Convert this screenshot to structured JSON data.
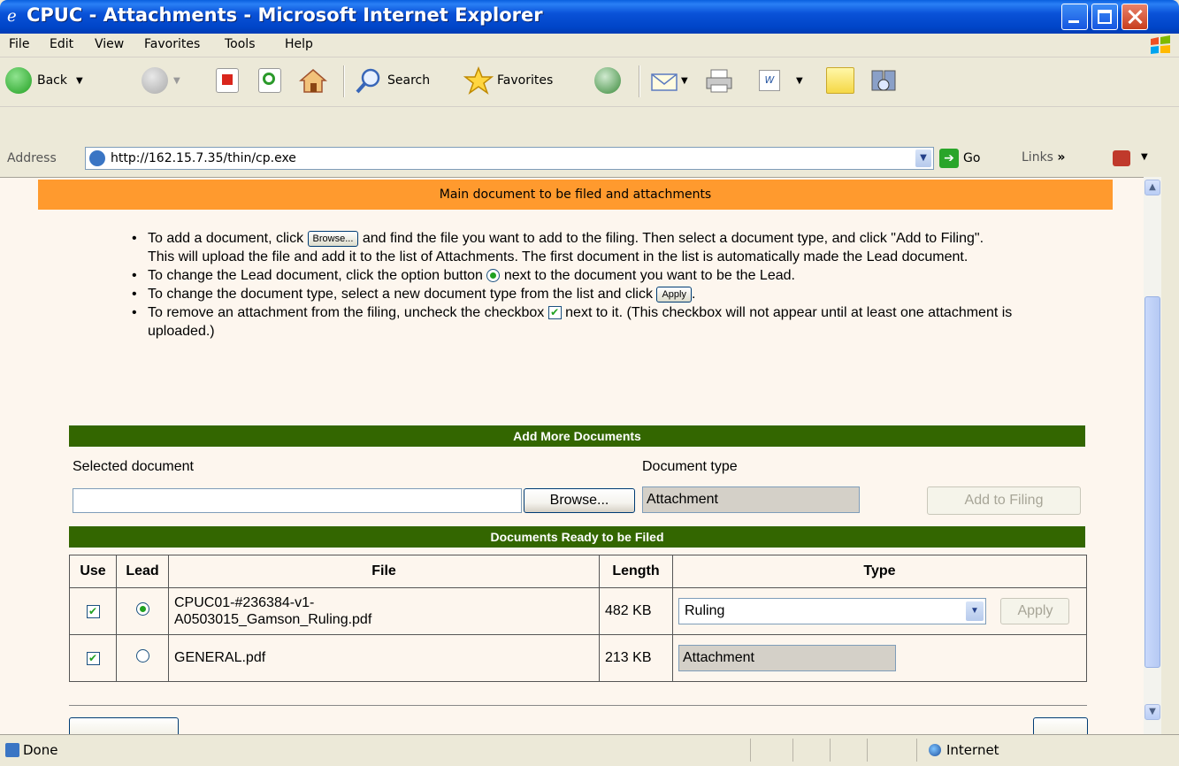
{
  "window": {
    "title": "CPUC - Attachments - Microsoft Internet Explorer"
  },
  "menu": [
    "File",
    "Edit",
    "View",
    "Favorites",
    "Tools",
    "Help"
  ],
  "toolbar": {
    "back_label": "Back",
    "search_label": "Search",
    "favorites_label": "Favorites"
  },
  "address": {
    "label": "Address",
    "url": "http://162.15.7.35/thin/cp.exe",
    "go_label": "Go",
    "links_label": "Links"
  },
  "page": {
    "header": "Main document to be filed and attachments",
    "instructions": {
      "i1_before": "To add a document, click",
      "i1_btn": "Browse...",
      "i1_after": "and find the file you want to add to the filing. Then select a document type, and click \"Add to Filing\". This will upload the file and add it to the list of Attachments. The first document in the list is automatically made the Lead document.",
      "i2_before": "To change the Lead document, click the option button",
      "i2_after": "next to the document you want to be the Lead.",
      "i3_before": "To change the document type, select a new document type from the list and click",
      "i3_btn": "Apply",
      "i3_after": ".",
      "i4_before": "To remove an attachment from the filing, uncheck the checkbox",
      "i4_after": "next to it. (This checkbox will not appear until at least one attachment is uploaded.)"
    },
    "add_more": {
      "header": "Add More Documents",
      "selected_label": "Selected document",
      "selected_value": "",
      "browse_label": "Browse...",
      "doctype_label": "Document type",
      "doctype_value": "Attachment",
      "add_button": "Add to Filing"
    },
    "ready": {
      "header": "Documents Ready to be Filed",
      "columns": [
        "Use",
        "Lead",
        "File",
        "Length",
        "Type"
      ],
      "rows": [
        {
          "use": true,
          "lead": true,
          "file_line1": "CPUC01-#236384-v1-",
          "file_line2": "A0503015_Gamson_Ruling.pdf",
          "length": "482 KB",
          "type": "Ruling",
          "apply": "Apply"
        },
        {
          "use": true,
          "lead": false,
          "file_line1": "GENERAL.pdf",
          "file_line2": "",
          "length": "213 KB",
          "type": "Attachment"
        }
      ]
    }
  },
  "status": {
    "text": "Done",
    "zone": "Internet"
  }
}
